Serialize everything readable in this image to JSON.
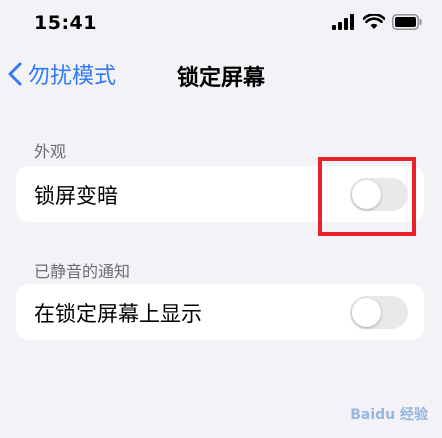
{
  "status_bar": {
    "time": "15:41"
  },
  "nav": {
    "back_label": "勿扰模式",
    "title": "锁定屏幕"
  },
  "sections": [
    {
      "header": "外观",
      "row_label": "锁屏变暗",
      "toggle_on": false
    },
    {
      "header": "已静音的通知",
      "row_label": "在锁定屏幕上显示",
      "toggle_on": false
    }
  ],
  "colors": {
    "accent": "#3478f6",
    "background": "#f2f2f7",
    "highlight": "#e8212b"
  },
  "watermark": "Baidu 经验"
}
